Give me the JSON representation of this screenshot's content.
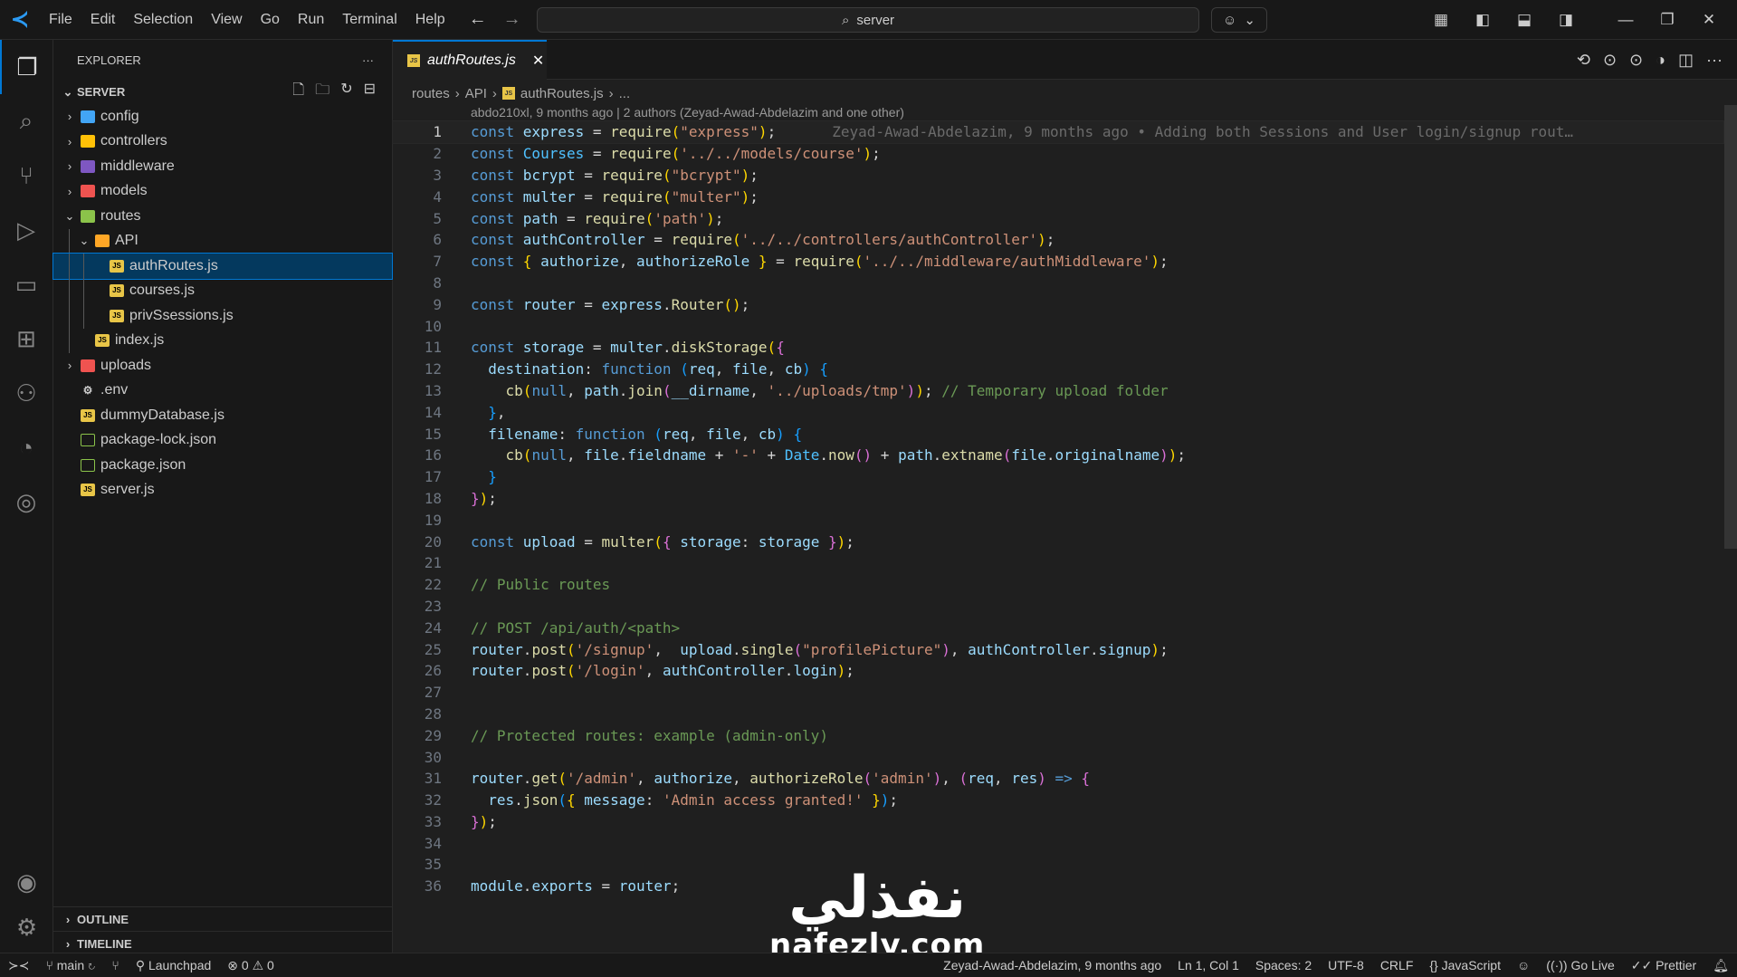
{
  "titlebar": {
    "menu": [
      "File",
      "Edit",
      "Selection",
      "View",
      "Go",
      "Run",
      "Terminal",
      "Help"
    ],
    "search": "server"
  },
  "explorer": {
    "title": "EXPLORER",
    "section": "SERVER",
    "items": [
      {
        "label": "config",
        "type": "folder",
        "depth": 0,
        "open": false,
        "color": "#42a5f5"
      },
      {
        "label": "controllers",
        "type": "folder",
        "depth": 0,
        "open": false,
        "color": "#ffc107"
      },
      {
        "label": "middleware",
        "type": "folder",
        "depth": 0,
        "open": false,
        "color": "#7e57c2"
      },
      {
        "label": "models",
        "type": "folder",
        "depth": 0,
        "open": false,
        "color": "#ef5350"
      },
      {
        "label": "routes",
        "type": "folder",
        "depth": 0,
        "open": true,
        "color": "#8bc34a"
      },
      {
        "label": "API",
        "type": "folder",
        "depth": 1,
        "open": true,
        "color": "#ffa726"
      },
      {
        "label": "authRoutes.js",
        "type": "js",
        "depth": 2,
        "selected": true
      },
      {
        "label": "courses.js",
        "type": "js",
        "depth": 2
      },
      {
        "label": "privSsessions.js",
        "type": "js",
        "depth": 2
      },
      {
        "label": "index.js",
        "type": "js",
        "depth": 1
      },
      {
        "label": "uploads",
        "type": "folder",
        "depth": 0,
        "open": false,
        "color": "#ef5350"
      },
      {
        "label": ".env",
        "type": "env",
        "depth": 0
      },
      {
        "label": "dummyDatabase.js",
        "type": "js",
        "depth": 0
      },
      {
        "label": "package-lock.json",
        "type": "npm",
        "depth": 0
      },
      {
        "label": "package.json",
        "type": "npm",
        "depth": 0
      },
      {
        "label": "server.js",
        "type": "js",
        "depth": 0
      }
    ],
    "outline": "OUTLINE",
    "timeline": "TIMELINE"
  },
  "editor": {
    "tab": "authRoutes.js",
    "breadcrumb": [
      "routes",
      "API",
      "authRoutes.js",
      "..."
    ],
    "blame_header": "abdo210xl, 9 months ago | 2 authors (Zeyad-Awad-Abdelazim and one other)",
    "inline_blame": "Zeyad-Awad-Abdelazim, 9 months ago • Adding both Sessions and User login/signup rout…",
    "lines": [
      [
        [
          "const ",
          "k"
        ],
        [
          "express",
          "v"
        ],
        [
          " = ",
          "p"
        ],
        [
          "require",
          "f"
        ],
        [
          "(",
          "b1"
        ],
        [
          "\"express\"",
          "s"
        ],
        [
          ")",
          "b1"
        ],
        [
          ";",
          "p"
        ]
      ],
      [
        [
          "const ",
          "k"
        ],
        [
          "Courses",
          "C"
        ],
        [
          " = ",
          "p"
        ],
        [
          "require",
          "f"
        ],
        [
          "(",
          "b1"
        ],
        [
          "'../../models/course'",
          "s"
        ],
        [
          ")",
          "b1"
        ],
        [
          ";",
          "p"
        ]
      ],
      [
        [
          "const ",
          "k"
        ],
        [
          "bcrypt",
          "v"
        ],
        [
          " = ",
          "p"
        ],
        [
          "require",
          "f"
        ],
        [
          "(",
          "b1"
        ],
        [
          "\"bcrypt\"",
          "s"
        ],
        [
          ")",
          "b1"
        ],
        [
          ";",
          "p"
        ]
      ],
      [
        [
          "const ",
          "k"
        ],
        [
          "multer",
          "v"
        ],
        [
          " = ",
          "p"
        ],
        [
          "require",
          "f"
        ],
        [
          "(",
          "b1"
        ],
        [
          "\"multer\"",
          "s"
        ],
        [
          ")",
          "b1"
        ],
        [
          ";",
          "p"
        ]
      ],
      [
        [
          "const ",
          "k"
        ],
        [
          "path",
          "v"
        ],
        [
          " = ",
          "p"
        ],
        [
          "require",
          "f"
        ],
        [
          "(",
          "b1"
        ],
        [
          "'path'",
          "s"
        ],
        [
          ")",
          "b1"
        ],
        [
          ";",
          "p"
        ]
      ],
      [
        [
          "const ",
          "k"
        ],
        [
          "authController",
          "v"
        ],
        [
          " = ",
          "p"
        ],
        [
          "require",
          "f"
        ],
        [
          "(",
          "b1"
        ],
        [
          "'../../controllers/authController'",
          "s"
        ],
        [
          ")",
          "b1"
        ],
        [
          ";",
          "p"
        ]
      ],
      [
        [
          "const ",
          "k"
        ],
        [
          "{",
          "b1"
        ],
        [
          " authorize",
          "v"
        ],
        [
          ", ",
          "p"
        ],
        [
          "authorizeRole",
          "v"
        ],
        [
          " }",
          "b1"
        ],
        [
          " = ",
          "p"
        ],
        [
          "require",
          "f"
        ],
        [
          "(",
          "b1"
        ],
        [
          "'../../middleware/authMiddleware'",
          "s"
        ],
        [
          ")",
          "b1"
        ],
        [
          ";",
          "p"
        ]
      ],
      [],
      [
        [
          "const ",
          "k"
        ],
        [
          "router",
          "v"
        ],
        [
          " = ",
          "p"
        ],
        [
          "express",
          "v"
        ],
        [
          ".",
          "p"
        ],
        [
          "Router",
          "f"
        ],
        [
          "()",
          "b1"
        ],
        [
          ";",
          "p"
        ]
      ],
      [],
      [
        [
          "const ",
          "k"
        ],
        [
          "storage",
          "v"
        ],
        [
          " = ",
          "p"
        ],
        [
          "multer",
          "v"
        ],
        [
          ".",
          "p"
        ],
        [
          "diskStorage",
          "f"
        ],
        [
          "(",
          "b1"
        ],
        [
          "{",
          "b2"
        ]
      ],
      [
        [
          "  destination",
          "v"
        ],
        [
          ": ",
          "p"
        ],
        [
          "function ",
          "k"
        ],
        [
          "(",
          "b3"
        ],
        [
          "req",
          "v"
        ],
        [
          ", ",
          "p"
        ],
        [
          "file",
          "v"
        ],
        [
          ", ",
          "p"
        ],
        [
          "cb",
          "v"
        ],
        [
          ")",
          "b3"
        ],
        [
          " ",
          "p"
        ],
        [
          "{",
          "b3"
        ]
      ],
      [
        [
          "    cb",
          "f"
        ],
        [
          "(",
          "b1"
        ],
        [
          "null",
          "k"
        ],
        [
          ", ",
          "p"
        ],
        [
          "path",
          "v"
        ],
        [
          ".",
          "p"
        ],
        [
          "join",
          "f"
        ],
        [
          "(",
          "b2"
        ],
        [
          "__dirname",
          "v"
        ],
        [
          ", ",
          "p"
        ],
        [
          "'../uploads/tmp'",
          "s"
        ],
        [
          ")",
          "b2"
        ],
        [
          ")",
          "b1"
        ],
        [
          ";",
          "p"
        ],
        [
          " // Temporary upload folder",
          "c"
        ]
      ],
      [
        [
          "  }",
          "b3"
        ],
        [
          ",",
          "p"
        ]
      ],
      [
        [
          "  filename",
          "v"
        ],
        [
          ": ",
          "p"
        ],
        [
          "function ",
          "k"
        ],
        [
          "(",
          "b3"
        ],
        [
          "req",
          "v"
        ],
        [
          ", ",
          "p"
        ],
        [
          "file",
          "v"
        ],
        [
          ", ",
          "p"
        ],
        [
          "cb",
          "v"
        ],
        [
          ")",
          "b3"
        ],
        [
          " ",
          "p"
        ],
        [
          "{",
          "b3"
        ]
      ],
      [
        [
          "    cb",
          "f"
        ],
        [
          "(",
          "b1"
        ],
        [
          "null",
          "k"
        ],
        [
          ", ",
          "p"
        ],
        [
          "file",
          "v"
        ],
        [
          ".",
          "p"
        ],
        [
          "fieldname",
          "v"
        ],
        [
          " + ",
          "p"
        ],
        [
          "'-'",
          "s"
        ],
        [
          " + ",
          "p"
        ],
        [
          "Date",
          "C"
        ],
        [
          ".",
          "p"
        ],
        [
          "now",
          "f"
        ],
        [
          "()",
          "b2"
        ],
        [
          " + ",
          "p"
        ],
        [
          "path",
          "v"
        ],
        [
          ".",
          "p"
        ],
        [
          "extname",
          "f"
        ],
        [
          "(",
          "b2"
        ],
        [
          "file",
          "v"
        ],
        [
          ".",
          "p"
        ],
        [
          "originalname",
          "v"
        ],
        [
          ")",
          "b2"
        ],
        [
          ")",
          "b1"
        ],
        [
          ";",
          "p"
        ]
      ],
      [
        [
          "  }",
          "b3"
        ]
      ],
      [
        [
          "}",
          "b2"
        ],
        [
          ")",
          "b1"
        ],
        [
          ";",
          "p"
        ]
      ],
      [],
      [
        [
          "const ",
          "k"
        ],
        [
          "upload",
          "v"
        ],
        [
          " = ",
          "p"
        ],
        [
          "multer",
          "f"
        ],
        [
          "(",
          "b1"
        ],
        [
          "{",
          "b2"
        ],
        [
          " storage",
          "v"
        ],
        [
          ": ",
          "p"
        ],
        [
          "storage",
          "v"
        ],
        [
          " }",
          "b2"
        ],
        [
          ")",
          "b1"
        ],
        [
          ";",
          "p"
        ]
      ],
      [],
      [
        [
          "// Public routes",
          "c"
        ]
      ],
      [],
      [
        [
          "// POST /api/auth/<path>",
          "c"
        ]
      ],
      [
        [
          "router",
          "v"
        ],
        [
          ".",
          "p"
        ],
        [
          "post",
          "f"
        ],
        [
          "(",
          "b1"
        ],
        [
          "'/signup'",
          "s"
        ],
        [
          ",  ",
          "p"
        ],
        [
          "upload",
          "v"
        ],
        [
          ".",
          "p"
        ],
        [
          "single",
          "f"
        ],
        [
          "(",
          "b2"
        ],
        [
          "\"profilePicture\"",
          "s"
        ],
        [
          ")",
          "b2"
        ],
        [
          ", ",
          "p"
        ],
        [
          "authController",
          "v"
        ],
        [
          ".",
          "p"
        ],
        [
          "signup",
          "v"
        ],
        [
          ")",
          "b1"
        ],
        [
          ";",
          "p"
        ]
      ],
      [
        [
          "router",
          "v"
        ],
        [
          ".",
          "p"
        ],
        [
          "post",
          "f"
        ],
        [
          "(",
          "b1"
        ],
        [
          "'/login'",
          "s"
        ],
        [
          ", ",
          "p"
        ],
        [
          "authController",
          "v"
        ],
        [
          ".",
          "p"
        ],
        [
          "login",
          "v"
        ],
        [
          ")",
          "b1"
        ],
        [
          ";",
          "p"
        ]
      ],
      [],
      [],
      [
        [
          "// Protected routes: example (admin-only)",
          "c"
        ]
      ],
      [],
      [
        [
          "router",
          "v"
        ],
        [
          ".",
          "p"
        ],
        [
          "get",
          "f"
        ],
        [
          "(",
          "b1"
        ],
        [
          "'/admin'",
          "s"
        ],
        [
          ", ",
          "p"
        ],
        [
          "authorize",
          "v"
        ],
        [
          ", ",
          "p"
        ],
        [
          "authorizeRole",
          "f"
        ],
        [
          "(",
          "b2"
        ],
        [
          "'admin'",
          "s"
        ],
        [
          ")",
          "b2"
        ],
        [
          ", ",
          "p"
        ],
        [
          "(",
          "b2"
        ],
        [
          "req",
          "v"
        ],
        [
          ", ",
          "p"
        ],
        [
          "res",
          "v"
        ],
        [
          ")",
          "b2"
        ],
        [
          " => ",
          "k"
        ],
        [
          "{",
          "b2"
        ]
      ],
      [
        [
          "  res",
          "v"
        ],
        [
          ".",
          "p"
        ],
        [
          "json",
          "f"
        ],
        [
          "(",
          "b3"
        ],
        [
          "{",
          "b1"
        ],
        [
          " message",
          "v"
        ],
        [
          ": ",
          "p"
        ],
        [
          "'Admin access granted!'",
          "s"
        ],
        [
          " }",
          "b1"
        ],
        [
          ")",
          "b3"
        ],
        [
          ";",
          "p"
        ]
      ],
      [
        [
          "}",
          "b2"
        ],
        [
          ")",
          "b1"
        ],
        [
          ";",
          "p"
        ]
      ],
      [],
      [],
      [
        [
          "module",
          "v"
        ],
        [
          ".",
          "p"
        ],
        [
          "exports",
          "v"
        ],
        [
          " = ",
          "p"
        ],
        [
          "router",
          "v"
        ],
        [
          ";",
          "p"
        ]
      ]
    ]
  },
  "statusbar": {
    "branch": "main",
    "launchpad": "Launchpad",
    "errors": "0",
    "warnings": "0",
    "blame": "Zeyad-Awad-Abdelazim, 9 months ago",
    "position": "Ln 1, Col 1",
    "spaces": "Spaces: 2",
    "encoding": "UTF-8",
    "eol": "CRLF",
    "language": "JavaScript",
    "golive": "Go Live",
    "prettier": "Prettier"
  },
  "watermark": {
    "arabic": "نفذلي",
    "latin": "nafezly.com"
  }
}
